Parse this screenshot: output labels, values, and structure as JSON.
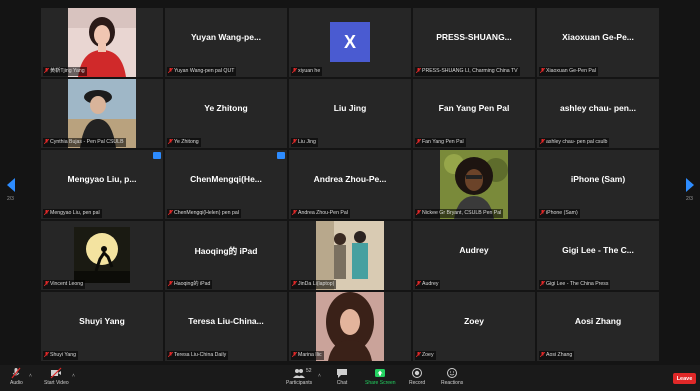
{
  "participants": [
    {
      "label": "黄靳Tjing Yang",
      "name": "",
      "photo": "red"
    },
    {
      "label": "Yuyan Wang-pen pal QUT",
      "name": "Yuyan Wang-pe..."
    },
    {
      "label": "xiyuan he",
      "name": "",
      "avatar_letter": "X"
    },
    {
      "label": "PRESS-SHUANG LI, Charming China TV",
      "name": "PRESS-SHUANG..."
    },
    {
      "label": "Xiaoxuan Ge-Pen Pal",
      "name": "Xiaoxuan Ge-Pe..."
    },
    {
      "label": "Cynthia Bujas - Pen Pal CSULB",
      "name": "",
      "photo": "hat"
    },
    {
      "label": "Ye Zhitong",
      "name": "Ye Zhitong"
    },
    {
      "label": "Liu Jing",
      "name": "Liu Jing"
    },
    {
      "label": "Fan Yang Pen Pal",
      "name": "Fan Yang Pen Pal"
    },
    {
      "label": "ashley chau- pen pal csulb",
      "name": "ashley chau- pen..."
    },
    {
      "label": "Mengyao Liu, pen pal",
      "name": "Mengyao Liu, p...",
      "pinned": true
    },
    {
      "label": "ChenMengqi(Helen) pen pal",
      "name": "ChenMengqi(He...",
      "pinned": true
    },
    {
      "label": "Andrea Zhou-Pen Pal",
      "name": "Andrea Zhou-Pe..."
    },
    {
      "label": "Nickee Gr Bryant, CSULB Pen Pal",
      "name": "",
      "photo": "curly"
    },
    {
      "label": "iPhone (Sam)",
      "name": "iPhone (Sam)"
    },
    {
      "label": "Vincent Leong",
      "name": "",
      "photo": "moon"
    },
    {
      "label": "Haoqing的 iPad",
      "name": "Haoqing的 iPad"
    },
    {
      "label": "JinDa Li(laptop)",
      "name": "",
      "photo": "couple"
    },
    {
      "label": "Audrey",
      "name": "Audrey"
    },
    {
      "label": "Gigi Lee - The China Press",
      "name": "Gigi Lee - The C..."
    },
    {
      "label": "Shuyi Yang",
      "name": "Shuyi Yang"
    },
    {
      "label": "Teresa Liu-China Daily",
      "name": "Teresa Liu-China..."
    },
    {
      "label": "Marina Ilic",
      "name": "",
      "photo": "curlyhair"
    },
    {
      "label": "Zoey",
      "name": "Zoey"
    },
    {
      "label": "Aosi Zhang",
      "name": "Aosi Zhang"
    }
  ],
  "pager": {
    "left": "2/3",
    "right": "2/3"
  },
  "toolbar": {
    "audio": "Audio",
    "video": "Start Video",
    "participants": "Participants",
    "participants_count": "52",
    "chat": "Chat",
    "share": "Share Screen",
    "record": "Record",
    "reactions": "Reactions",
    "leave": "Leave"
  },
  "colors": {
    "accent": "#2d8cff",
    "share": "#23d160",
    "leave": "#e02828",
    "tile": "#262626"
  }
}
